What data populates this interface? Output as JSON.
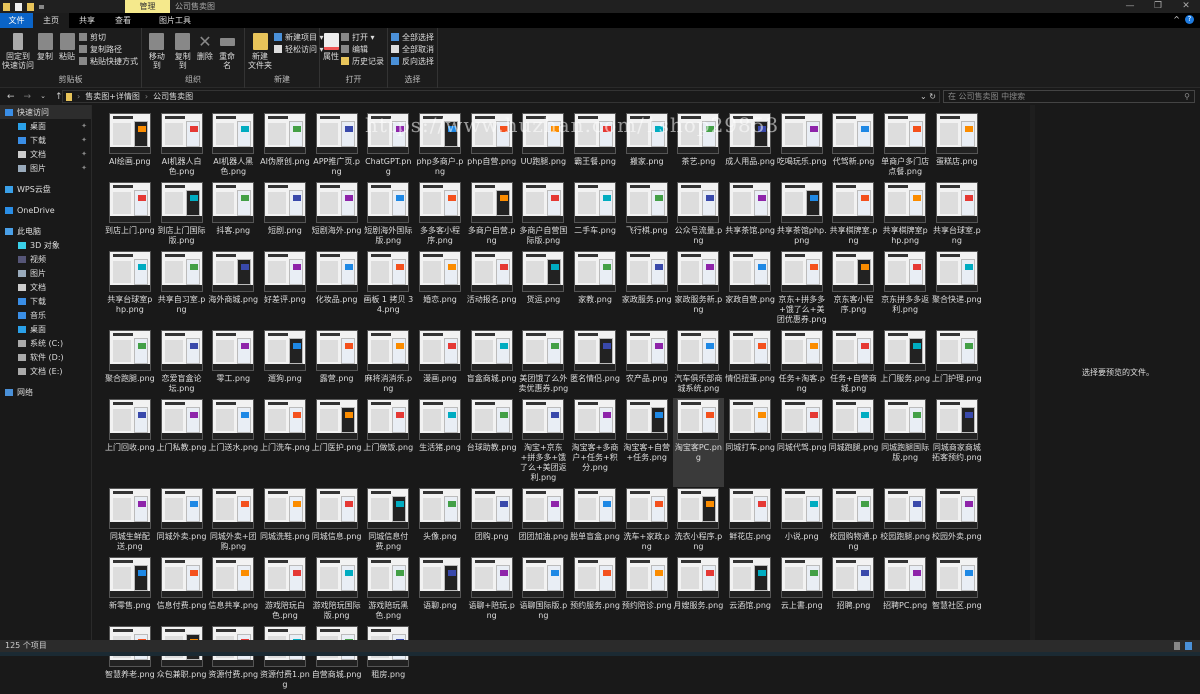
{
  "window": {
    "title": "公司售卖图",
    "context_tab": "管理",
    "minimize": "—",
    "maximize": "❐",
    "close": "✕"
  },
  "tabs": [
    "文件",
    "主页",
    "共享",
    "查看",
    "图片工具"
  ],
  "ribbon": {
    "clipboard": {
      "label": "剪贴板",
      "pin": "固定到\n快速访问",
      "copy": "复制",
      "paste": "粘贴",
      "cut": "剪切",
      "copy_path": "复制路径",
      "paste_shortcut": "粘贴快捷方式"
    },
    "organize": {
      "label": "组织",
      "move_to": "移动到",
      "copy_to": "复制到",
      "delete": "删除",
      "rename": "重命名"
    },
    "new": {
      "label": "新建",
      "new_folder": "新建\n文件夹",
      "new_item": "新建项目 ▾",
      "easy_access": "轻松访问 ▾"
    },
    "open": {
      "label": "打开",
      "properties": "属性",
      "open": "打开 ▾",
      "edit": "编辑",
      "history": "历史记录"
    },
    "select": {
      "label": "选择",
      "select_all": "全部选择",
      "select_none": "全部取消",
      "invert": "反向选择"
    }
  },
  "address": {
    "breadcrumb": [
      "售卖图+详情图",
      "公司售卖图"
    ],
    "search_placeholder": "在 公司售卖图 中搜索"
  },
  "sidebar": [
    {
      "label": "快速访问",
      "top": true,
      "icon": "star-icon",
      "color": "#3a8ee6"
    },
    {
      "label": "桌面",
      "pin": true,
      "icon": "desktop-icon",
      "color": "#2aa0e8"
    },
    {
      "label": "下载",
      "pin": true,
      "icon": "download-icon",
      "color": "#3a8ee6"
    },
    {
      "label": "文档",
      "pin": true,
      "icon": "document-icon",
      "color": "#cccccc"
    },
    {
      "label": "图片",
      "pin": true,
      "icon": "pictures-icon",
      "color": "#9ab"
    },
    {
      "label": "WPS云盘",
      "top": true,
      "gap": true,
      "icon": "cloud-icon",
      "color": "#3aa0e8"
    },
    {
      "label": "OneDrive",
      "top": true,
      "gap": true,
      "icon": "onedrive-icon",
      "color": "#2a8ee6"
    },
    {
      "label": "此电脑",
      "top": true,
      "gap": true,
      "icon": "computer-icon",
      "color": "#4aa0e8"
    },
    {
      "label": "3D 对象",
      "icon": "3d-objects-icon",
      "color": "#3ad0e8"
    },
    {
      "label": "视频",
      "icon": "video-icon",
      "color": "#557"
    },
    {
      "label": "图片",
      "icon": "pictures-icon",
      "color": "#9ab"
    },
    {
      "label": "文档",
      "icon": "document-icon",
      "color": "#cccccc"
    },
    {
      "label": "下载",
      "icon": "download-icon",
      "color": "#3a8ee6"
    },
    {
      "label": "音乐",
      "icon": "music-icon",
      "color": "#3a8ee6"
    },
    {
      "label": "桌面",
      "icon": "desktop-icon",
      "color": "#2aa0e8"
    },
    {
      "label": "系统 (C:)",
      "icon": "drive-icon",
      "color": "#aaa"
    },
    {
      "label": "软件 (D:)",
      "icon": "drive-icon",
      "color": "#aaa"
    },
    {
      "label": "文档 (E:)",
      "icon": "drive-icon",
      "color": "#aaa"
    },
    {
      "label": "网络",
      "top": true,
      "gap": true,
      "icon": "network-icon",
      "color": "#4a90d8"
    }
  ],
  "files": [
    "AI绘画.png",
    "AI机器人白色.png",
    "AI机器人黑色.png",
    "AI伪原创.png",
    "APP推广页.png",
    "ChatGPT.png",
    "php多商户.png",
    "php自营.png",
    "UU跑腿.png",
    "霸王餐.png",
    "搬家.png",
    "茶艺.png",
    "成人用品.png",
    "吃喝玩乐.png",
    "代驾新.png",
    "单商户多门店点餐.png",
    "蛋糕店.png",
    "到店上门.png",
    "到店上门国际版.png",
    "抖客.png",
    "短剧.png",
    "短剧海外.png",
    "短剧海外国际版.png",
    "多多客小程序.png",
    "多商户自营.png",
    "多商户自营国际版.png",
    "二手车.png",
    "飞行棋.png",
    "公众号流量.png",
    "共享茶馆.png",
    "共享茶馆php.png",
    "共享棋牌室.png",
    "共享棋牌室php.png",
    "共享台球室.png",
    "共享台球室php.png",
    "共享自习室.png",
    "海外商城.png",
    "好差评.png",
    "化妆品.png",
    "画板 1 拷贝 34.png",
    "婚恋.png",
    "活动报名.png",
    "货运.png",
    "家教.png",
    "家政服务.png",
    "家政服务新.png",
    "家政自营.png",
    "京东+拼多多+饿了么+美团优惠券.png",
    "京东客小程序.png",
    "京东拼多多返利.png",
    "聚合快递.png",
    "聚合跑腿.png",
    "恋爱盲盒论坛.png",
    "零工.png",
    "遛狗.png",
    "露营.png",
    "麻将消消乐.png",
    "漫画.png",
    "盲盒商城.png",
    "美团饿了么外卖优惠券.png",
    "匿名情侣.png",
    "农产品.png",
    "汽车俱乐部商城系统.png",
    "情侣扭蛋.png",
    "任务+淘客.png",
    "任务+自营商城.png",
    "上门服务.png",
    "上门护理.png",
    "上门回收.png",
    "上门私教.png",
    "上门送水.png",
    "上门洗车.png",
    "上门医护.png",
    "上门做饭.png",
    "生活猪.png",
    "台球助教.png",
    "淘宝+京东+拼多多+饿了么+美团返利.png",
    "淘宝客+多商户+任务+积分.png",
    "淘宝客+自营+任务.png",
    "淘宝客PC.png",
    "同城打车.png",
    "同城代驾.png",
    "同城跑腿.png",
    "同城跑腿国际版.png",
    "同城商家商城拓客预约.png",
    "同城生鲜配送.png",
    "同城外卖.png",
    "同城外卖+团购.png",
    "同城洗鞋.png",
    "同城信息.png",
    "同城信息付费.png",
    "头像.png",
    "团购.png",
    "团团加油.png",
    "脱单盲盒.png",
    "洗车+家政.png",
    "洗衣小程序.png",
    "鲜花店.png",
    "小说.png",
    "校园购物通.png",
    "校园跑腿.png",
    "校园外卖.png",
    "新零售.png",
    "信息付费.png",
    "信息共享.png",
    "游戏陪玩白色.png",
    "游戏陪玩国际版.png",
    "游戏陪玩黑色.png",
    "语聊.png",
    "语聊+陪玩.png",
    "语聊国际版.png",
    "预约服务.png",
    "预约陪诊.png",
    "月嫂服务.png",
    "云酒馆.png",
    "云上書.png",
    "招聘.png",
    "招聘PC.png",
    "智慧社区.png",
    "智慧养老.png",
    "众包兼职.png",
    "资源付费.png",
    "资源付费1.png",
    "自营商城.png",
    "租房.png"
  ],
  "selected_file": "淘宝客PC.png",
  "preview_text": "选择要预览的文件。",
  "status": {
    "count": "125 个项目"
  },
  "watermark": "https://www.huzhan.com/1shop29853",
  "colors": {
    "file_tab": "#0a64c8",
    "context_tab": "#f5e98c",
    "background": "#191919"
  }
}
